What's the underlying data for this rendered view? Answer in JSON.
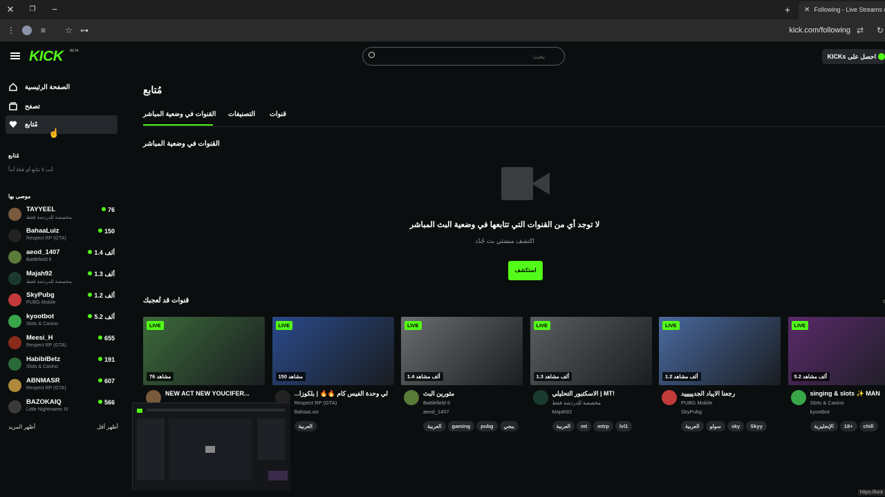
{
  "browser": {
    "tab_title": "Following - Live Streams on K",
    "url": "kick.com/following"
  },
  "header": {
    "logo": "KICK",
    "logo_badge": "BETA",
    "search_placeholder": "بحث",
    "kicks_button": "احصل على KICKs"
  },
  "sidebar": {
    "nav": [
      {
        "label": "الصفحة الرئيسية",
        "icon": "home-icon"
      },
      {
        "label": "تصفح",
        "icon": "browse-icon"
      },
      {
        "label": "مُتابع",
        "icon": "heart-icon"
      }
    ],
    "following_heading": "مُتابع",
    "following_empty": "أنت لا تتابع أي قناة أبداً",
    "recommended_heading": "موصى بها",
    "channels": [
      {
        "name": "TAYYEEL",
        "category": "مخصصة للدردشة فقط",
        "viewers": "76",
        "color": "#7a5a3c"
      },
      {
        "name": "BahaaLuiz",
        "category": "Respect RP (GTA)",
        "viewers": "150",
        "color": "#222222"
      },
      {
        "name": "aeod_1407",
        "category": "Battlefield 6",
        "viewers": "1.4 ألف",
        "color": "#5a7a3a"
      },
      {
        "name": "Majah92",
        "category": "مخصصة للدردشة فقط",
        "viewers": "1.3 ألف",
        "color": "#1b3a2e"
      },
      {
        "name": "SkyPubg",
        "category": "PUBG Mobile",
        "viewers": "1.2 ألف",
        "color": "#c23a3a"
      },
      {
        "name": "kyootbot",
        "category": "Slots & Casino",
        "viewers": "5.2 ألف",
        "color": "#3aa64a"
      },
      {
        "name": "Meesi_H",
        "category": "Respect RP (GTA)",
        "viewers": "655",
        "color": "#8a2a1a"
      },
      {
        "name": "HabibiBetz",
        "category": "Slots & Casino",
        "viewers": "191",
        "color": "#2a6a3a"
      },
      {
        "name": "ABNMASR",
        "category": "Respect RP (GTA)",
        "viewers": "607",
        "color": "#b08a3a"
      },
      {
        "name": "BAZOKAIQ",
        "category": "Little Nightmares III",
        "viewers": "566",
        "color": "#3a3a3a"
      }
    ],
    "show_more": "أظهر المزيد",
    "show_less": "أظهر أقل"
  },
  "main": {
    "page_title": "مُتابع",
    "tabs": [
      "القنوات في وضعية المباشر",
      "التصنيفات",
      "قنوات"
    ],
    "live_section_title": "القنوات في وضعية المباشر",
    "empty_title": "لا توجد أي من القنوات التي تتابعها في وضعية البث المباشر",
    "empty_sub": "اكتشف منشئي بث جُدُد",
    "explore_button": "استكشف",
    "recommend_title": "قنوات قد تُعجبك",
    "live_badge": "LIVE",
    "cards": [
      {
        "title": "NEW ACT NEW YOUCIFER...",
        "category": "",
        "user": "",
        "viewers": "76 مشاهد",
        "tags": [],
        "thumb": "#3c6a3a",
        "avatar": "#7a5a3c"
      },
      {
        "title": "...لي وحدة الفيس كام 🔥🔥 | بلكوزا",
        "category": "Respect RP (GTA)",
        "user": "BahaaLuiz",
        "viewers": "150 مشاهد",
        "tags": [
          "العربية"
        ],
        "thumb": "#2a4a8a",
        "avatar": "#222222"
      },
      {
        "title": "مثورين البث",
        "category": "Battlefield 6",
        "user": "aeod_1407",
        "viewers": "1.4 ألف مشاهد",
        "tags": [
          "العربية",
          "gaming",
          "pubg",
          "ببجي"
        ],
        "thumb": "#6a6e70",
        "avatar": "#5a7a3a"
      },
      {
        "title": "الاسكتبور التحليلي | MT!",
        "category": "مخصصة للدردشة فقط",
        "user": "Majah92",
        "viewers": "1.3 ألف مشاهد",
        "tags": [
          "العربية",
          "mt",
          "mtrp",
          "lvl1"
        ],
        "thumb": "#5a5e60",
        "avatar": "#1b3a2e"
      },
      {
        "title": "رجعنا الايباد الجديييييد",
        "category": "PUBG Mobile",
        "user": "SkyPubg",
        "viewers": "1.2 ألف مشاهد",
        "tags": [
          "العربية",
          "سولو",
          "sky",
          "Skyy"
        ],
        "thumb": "#4a6aa0",
        "avatar": "#c23a3a"
      },
      {
        "title": "singing & slots ✨ MAN",
        "category": "Slots & Casino",
        "user": "kyootbot",
        "viewers": "5.2 ألف مشاهد",
        "tags": [
          "الإنجليزية",
          "18+",
          "chill"
        ],
        "thumb": "#5a2a6a",
        "avatar": "#3aa64a"
      }
    ]
  },
  "status_url": "https://kick"
}
